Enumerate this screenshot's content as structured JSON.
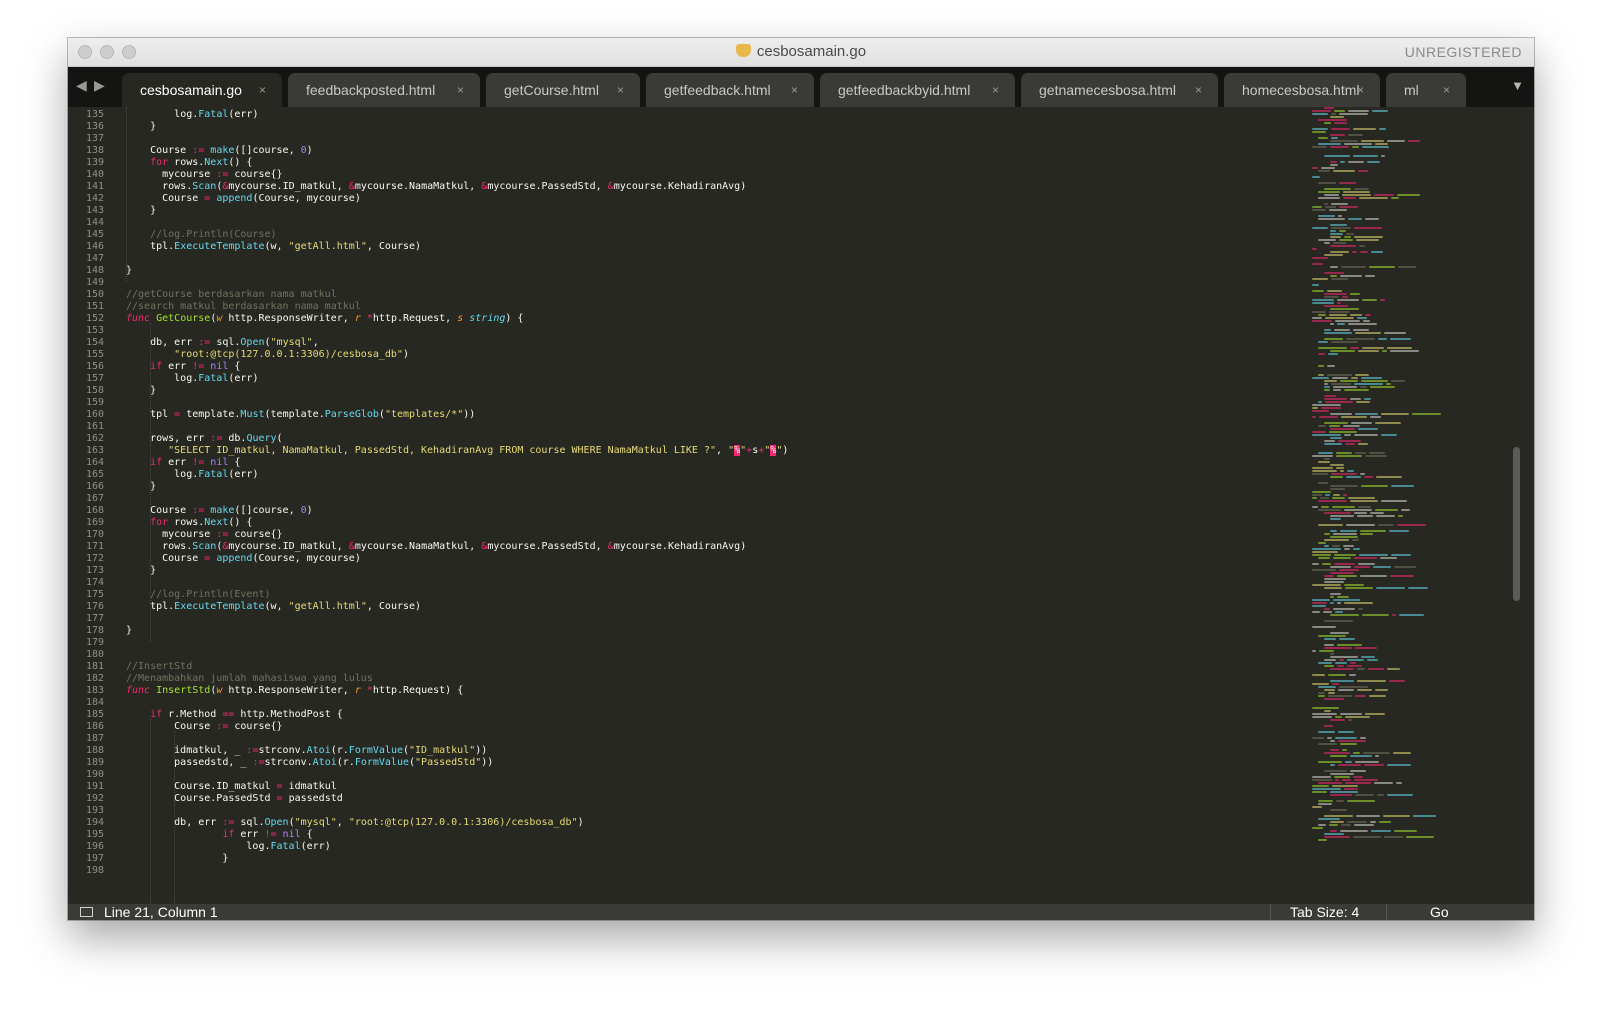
{
  "window": {
    "title": "cesbosamain.go",
    "registration": "UNREGISTERED",
    "traffic_lights": [
      "close",
      "minimize",
      "zoom"
    ]
  },
  "tabs": [
    {
      "label": "cesbosamain.go",
      "active": true
    },
    {
      "label": "feedbackposted.html",
      "active": false
    },
    {
      "label": "getCourse.html",
      "active": false
    },
    {
      "label": "getfeedback.html",
      "active": false
    },
    {
      "label": "getfeedbackbyid.html",
      "active": false
    },
    {
      "label": "getnamecesbosa.html",
      "active": false
    },
    {
      "label": "homecesbosa.html",
      "active": false
    },
    {
      "label": "ml",
      "active": false
    }
  ],
  "tab_close_glyph": "×",
  "nav": {
    "back": "◀",
    "forward": "▶",
    "more": "▼"
  },
  "editor": {
    "first_line": 135,
    "line_count": 64,
    "lines": [
      [
        [
          [
            "op_i",
            "        "
          ],
          [
            "",
            "log."
          ],
          [
            "fn",
            "Fatal"
          ],
          [
            "",
            "(err)"
          ]
        ]
      ],
      [
        [
          [
            "",
            "    }"
          ]
        ]
      ],
      [
        [
          [
            "",
            ""
          ]
        ]
      ],
      [
        [
          [
            "",
            "    Course "
          ],
          [
            "op",
            ":="
          ],
          [
            "",
            ""
          ],
          [
            "fn",
            " make"
          ],
          [
            "",
            "([]course, "
          ],
          [
            "num",
            "0"
          ],
          [
            "",
            ")"
          ]
        ]
      ],
      [
        [
          [
            "kw",
            "    for"
          ],
          [
            "",
            " rows."
          ],
          [
            "fn",
            "Next"
          ],
          [
            "",
            "() {"
          ]
        ]
      ],
      [
        [
          [
            "",
            "      mycourse "
          ],
          [
            "op",
            ":="
          ],
          [
            "",
            " course{}"
          ]
        ]
      ],
      [
        [
          [
            "",
            "      rows."
          ],
          [
            "fn",
            "Scan"
          ],
          [
            "",
            "("
          ],
          [
            "op",
            "&"
          ],
          [
            "",
            "mycourse.ID_matkul, "
          ],
          [
            "op",
            "&"
          ],
          [
            "",
            "mycourse.NamaMatkul, "
          ],
          [
            "op",
            "&"
          ],
          [
            "",
            "mycourse.PassedStd, "
          ],
          [
            "op",
            "&"
          ],
          [
            "",
            "mycourse.KehadiranAvg)"
          ]
        ]
      ],
      [
        [
          [
            "",
            "      Course "
          ],
          [
            "op",
            "="
          ],
          [
            "fn",
            " append"
          ],
          [
            "",
            "(Course, mycourse)"
          ]
        ]
      ],
      [
        [
          [
            "",
            "    }"
          ]
        ]
      ],
      [
        [
          [
            "",
            ""
          ]
        ]
      ],
      [
        [
          [
            "cmt",
            "    //log.Println(Course)"
          ]
        ]
      ],
      [
        [
          [
            "",
            "    tpl."
          ],
          [
            "fn",
            "ExecuteTemplate"
          ],
          [
            "",
            "(w, "
          ],
          [
            "str",
            "\"getAll.html\""
          ],
          [
            "",
            ", Course)"
          ]
        ]
      ],
      [
        [
          [
            "",
            ""
          ]
        ]
      ],
      [
        [
          [
            "",
            "}"
          ]
        ]
      ],
      [
        [
          [
            "",
            ""
          ]
        ]
      ],
      [
        [
          [
            "cmt",
            "//getCourse berdasarkan nama matkul"
          ]
        ]
      ],
      [
        [
          [
            "cmt",
            "//search matkul berdasarkan nama matkul"
          ]
        ]
      ],
      [
        [
          [
            "key",
            "func"
          ],
          [
            "def",
            " GetCourse"
          ],
          [
            "",
            "("
          ],
          [
            "par",
            "w"
          ],
          [
            "",
            " http.ResponseWriter, "
          ],
          [
            "par",
            "r"
          ],
          [
            "op",
            " *"
          ],
          [
            "",
            "http.Request, "
          ],
          [
            "par",
            "s"
          ],
          [
            "typ",
            " string"
          ],
          [
            "",
            ") {"
          ]
        ]
      ],
      [
        [
          [
            "",
            ""
          ]
        ]
      ],
      [
        [
          [
            "",
            "    db, err "
          ],
          [
            "op",
            ":="
          ],
          [
            "",
            " sql."
          ],
          [
            "fn",
            "Open"
          ],
          [
            "",
            "("
          ],
          [
            "str",
            "\"mysql\""
          ],
          [
            "",
            ","
          ]
        ]
      ],
      [
        [
          [
            "str",
            "        \"root:@tcp(127.0.0.1:3306)/cesbosa_db\""
          ],
          [
            "",
            ")"
          ]
        ]
      ],
      [
        [
          [
            "kw",
            "    if"
          ],
          [
            "",
            " err "
          ],
          [
            "op",
            "!="
          ],
          [
            "num",
            " nil"
          ],
          [
            "",
            " {"
          ]
        ]
      ],
      [
        [
          [
            "",
            "        log."
          ],
          [
            "fn",
            "Fatal"
          ],
          [
            "",
            "(err)"
          ]
        ]
      ],
      [
        [
          [
            "",
            "    }"
          ]
        ]
      ],
      [
        [
          [
            "",
            ""
          ]
        ]
      ],
      [
        [
          [
            "",
            "    tpl "
          ],
          [
            "op",
            "="
          ],
          [
            "",
            " template."
          ],
          [
            "fn",
            "Must"
          ],
          [
            "",
            "(template."
          ],
          [
            "fn",
            "ParseGlob"
          ],
          [
            "",
            "("
          ],
          [
            "str",
            "\"templates/*\""
          ],
          [
            "",
            "))"
          ]
        ]
      ],
      [
        [
          [
            "",
            ""
          ]
        ]
      ],
      [
        [
          [
            "",
            "    rows, err "
          ],
          [
            "op",
            ":="
          ],
          [
            "",
            " db."
          ],
          [
            "fn",
            "Query"
          ],
          [
            "",
            "("
          ]
        ]
      ],
      [
        [
          [
            "str",
            "       \"SELECT ID_matkul, NamaMatkul, PassedStd, KehadiranAvg FROM course WHERE NamaMatkul LIKE ?\""
          ],
          [
            "",
            ", "
          ],
          [
            "str",
            "\""
          ],
          [
            "hl",
            "%"
          ],
          [
            "str",
            "\""
          ],
          [
            "op",
            "+"
          ],
          [
            "",
            "s"
          ],
          [
            "op",
            "+"
          ],
          [
            "str",
            "\""
          ],
          [
            "hl",
            "%"
          ],
          [
            "str",
            "\""
          ],
          [
            "",
            ")"
          ]
        ]
      ],
      [
        [
          [
            "kw",
            "    if"
          ],
          [
            "",
            " err "
          ],
          [
            "op",
            "!="
          ],
          [
            "num",
            " nil"
          ],
          [
            "",
            " {"
          ]
        ]
      ],
      [
        [
          [
            "",
            "        log."
          ],
          [
            "fn",
            "Fatal"
          ],
          [
            "",
            "(err)"
          ]
        ]
      ],
      [
        [
          [
            "",
            "    }"
          ]
        ]
      ],
      [
        [
          [
            "",
            ""
          ]
        ]
      ],
      [
        [
          [
            "",
            "    Course "
          ],
          [
            "op",
            ":="
          ],
          [
            "fn",
            " make"
          ],
          [
            "",
            "([]course, "
          ],
          [
            "num",
            "0"
          ],
          [
            "",
            ")"
          ]
        ]
      ],
      [
        [
          [
            "kw",
            "    for"
          ],
          [
            "",
            " rows."
          ],
          [
            "fn",
            "Next"
          ],
          [
            "",
            "() {"
          ]
        ]
      ],
      [
        [
          [
            "",
            "      mycourse "
          ],
          [
            "op",
            ":="
          ],
          [
            "",
            " course{}"
          ]
        ]
      ],
      [
        [
          [
            "",
            "      rows."
          ],
          [
            "fn",
            "Scan"
          ],
          [
            "",
            "("
          ],
          [
            "op",
            "&"
          ],
          [
            "",
            "mycourse.ID_matkul, "
          ],
          [
            "op",
            "&"
          ],
          [
            "",
            "mycourse.NamaMatkul, "
          ],
          [
            "op",
            "&"
          ],
          [
            "",
            "mycourse.PassedStd, "
          ],
          [
            "op",
            "&"
          ],
          [
            "",
            "mycourse.KehadiranAvg)"
          ]
        ]
      ],
      [
        [
          [
            "",
            "      Course "
          ],
          [
            "op",
            "="
          ],
          [
            "fn",
            " append"
          ],
          [
            "",
            "(Course, mycourse)"
          ]
        ]
      ],
      [
        [
          [
            "",
            "    }"
          ]
        ]
      ],
      [
        [
          [
            "",
            ""
          ]
        ]
      ],
      [
        [
          [
            "cmt",
            "    //log.Println(Event)"
          ]
        ]
      ],
      [
        [
          [
            "",
            "    tpl."
          ],
          [
            "fn",
            "ExecuteTemplate"
          ],
          [
            "",
            "(w, "
          ],
          [
            "str",
            "\"getAll.html\""
          ],
          [
            "",
            ", Course)"
          ]
        ]
      ],
      [
        [
          [
            "",
            ""
          ]
        ]
      ],
      [
        [
          [
            "",
            "}"
          ]
        ]
      ],
      [
        [
          [
            "",
            ""
          ]
        ]
      ],
      [
        [
          [
            "",
            ""
          ]
        ]
      ],
      [
        [
          [
            "cmt",
            "//InsertStd"
          ]
        ]
      ],
      [
        [
          [
            "cmt",
            "//Menambahkan jumlah mahasiswa yang lulus"
          ]
        ]
      ],
      [
        [
          [
            "key",
            "func"
          ],
          [
            "def",
            " InsertStd"
          ],
          [
            "",
            "("
          ],
          [
            "par",
            "w"
          ],
          [
            "",
            " http.ResponseWriter, "
          ],
          [
            "par",
            "r"
          ],
          [
            "op",
            " *"
          ],
          [
            "",
            "http.Request) {"
          ]
        ]
      ],
      [
        [
          [
            "",
            ""
          ]
        ]
      ],
      [
        [
          [
            "kw",
            "    if"
          ],
          [
            "",
            " r.Method "
          ],
          [
            "op",
            "=="
          ],
          [
            "",
            " http.MethodPost {"
          ]
        ]
      ],
      [
        [
          [
            "",
            "        Course "
          ],
          [
            "op",
            ":="
          ],
          [
            "",
            " course{}"
          ]
        ]
      ],
      [
        [
          [
            "",
            ""
          ]
        ]
      ],
      [
        [
          [
            "",
            "        idmatkul, _ "
          ],
          [
            "op",
            ":="
          ],
          [
            "",
            "strconv."
          ],
          [
            "fn",
            "Atoi"
          ],
          [
            "",
            "(r."
          ],
          [
            "fn",
            "FormValue"
          ],
          [
            "",
            "("
          ],
          [
            "str",
            "\"ID_matkul\""
          ],
          [
            "",
            "))"
          ]
        ]
      ],
      [
        [
          [
            "",
            "        passedstd, _ "
          ],
          [
            "op",
            ":="
          ],
          [
            "",
            "strconv."
          ],
          [
            "fn",
            "Atoi"
          ],
          [
            "",
            "(r."
          ],
          [
            "fn",
            "FormValue"
          ],
          [
            "",
            "("
          ],
          [
            "str",
            "\"PassedStd\""
          ],
          [
            "",
            "))"
          ]
        ]
      ],
      [
        [
          [
            "",
            ""
          ]
        ]
      ],
      [
        [
          [
            "",
            "        Course.ID_matkul "
          ],
          [
            "op",
            "="
          ],
          [
            "",
            " idmatkul"
          ]
        ]
      ],
      [
        [
          [
            "",
            "        Course.PassedStd "
          ],
          [
            "op",
            "="
          ],
          [
            "",
            " passedstd"
          ]
        ]
      ],
      [
        [
          [
            "",
            ""
          ]
        ]
      ],
      [
        [
          [
            "",
            "        db, err "
          ],
          [
            "op",
            ":="
          ],
          [
            "",
            " sql."
          ],
          [
            "fn",
            "Open"
          ],
          [
            "",
            "("
          ],
          [
            "str",
            "\"mysql\""
          ],
          [
            "",
            ", "
          ],
          [
            "str",
            "\"root:@tcp(127.0.0.1:3306)/cesbosa_db\""
          ],
          [
            "",
            ")"
          ]
        ]
      ],
      [
        [
          [
            "kw",
            "                if"
          ],
          [
            "",
            " err "
          ],
          [
            "op",
            "!="
          ],
          [
            "num",
            " nil"
          ],
          [
            "",
            " {"
          ]
        ]
      ],
      [
        [
          [
            "",
            "                    log."
          ],
          [
            "fn",
            "Fatal"
          ],
          [
            "",
            "(err)"
          ]
        ]
      ],
      [
        [
          [
            "",
            "                }"
          ]
        ]
      ],
      [
        [
          [
            "",
            ""
          ]
        ]
      ]
    ]
  },
  "status": {
    "position": "Line 21, Column 1",
    "tab_size": "Tab Size: 4",
    "syntax": "Go"
  },
  "colors": {
    "background": "#272822",
    "keyword": "#f92672",
    "function": "#66d9ef",
    "definition": "#a6e22e",
    "string": "#e6db74",
    "number": "#ae81ff",
    "comment": "#75715e",
    "parameter": "#fd971f"
  }
}
